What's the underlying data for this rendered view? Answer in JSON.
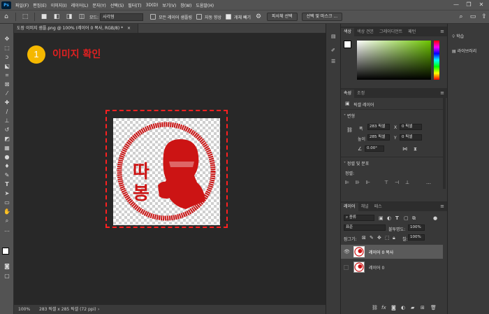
{
  "menubar": {
    "logo": "Ps",
    "items": [
      "파일(F)",
      "편집(E)",
      "이미지(I)",
      "레이어(L)",
      "문자(Y)",
      "선택(S)",
      "필터(T)",
      "3D(D)",
      "보기(V)",
      "창(W)",
      "도움말(H)"
    ]
  },
  "window_controls": {
    "minimize": "—",
    "restore": "❐",
    "close": "✕"
  },
  "options": {
    "mode_label": "모드:",
    "mode_value": "사각형",
    "sample_all_layers": "모든 레이어 샘플링",
    "enhance_edge": "자동 향상",
    "object_subtract": "개체 빼기",
    "select_subject": "피사체 선택",
    "select_and_mask": "선택 및 마스크 ..."
  },
  "document": {
    "tab_title": "도장 이미지 샘플.png @ 100% (레이어 0 복사, RGB/8) *",
    "tab_close": "×",
    "zoom": "100%",
    "status": "283 픽셀 x 285 픽셀 (72 ppi)"
  },
  "annotation": {
    "number": "1",
    "text": "이미지 확인",
    "badge_color": "#f5b800",
    "text_color": "#e02020"
  },
  "stamp": {
    "text": "따봉",
    "color": "#cc1414"
  },
  "color_panel": {
    "tabs": [
      "색상",
      "색상 견본",
      "그레이디언트",
      "패턴"
    ]
  },
  "properties_panel": {
    "tabs": [
      "속성",
      "조정"
    ],
    "layer_type": "픽셀 레이어",
    "transform_header": "변형",
    "w_label": "폭",
    "w_value": "283 픽셀",
    "x_label": "X",
    "x_value": "0 픽셀",
    "h_label": "높이",
    "h_value": "285 픽셀",
    "y_label": "Y",
    "y_value": "0 픽셀",
    "angle_value": "0.00°",
    "align_header": "정렬 및 분포",
    "align_label": "정렬:"
  },
  "layers_panel": {
    "tabs": [
      "레이어",
      "채널",
      "패스"
    ],
    "filter_label": "종류",
    "blend_mode": "표준",
    "opacity_label": "불투명도:",
    "opacity_value": "100%",
    "lock_label": "잠그기:",
    "fill_label": "칠:",
    "fill_value": "100%",
    "layers": [
      {
        "name": "레이어 0 복사",
        "visible": true,
        "selected": true
      },
      {
        "name": "레이어 0",
        "visible": false,
        "selected": false
      }
    ]
  },
  "side_libraries": {
    "items": [
      "학습",
      "라이브러리"
    ]
  }
}
